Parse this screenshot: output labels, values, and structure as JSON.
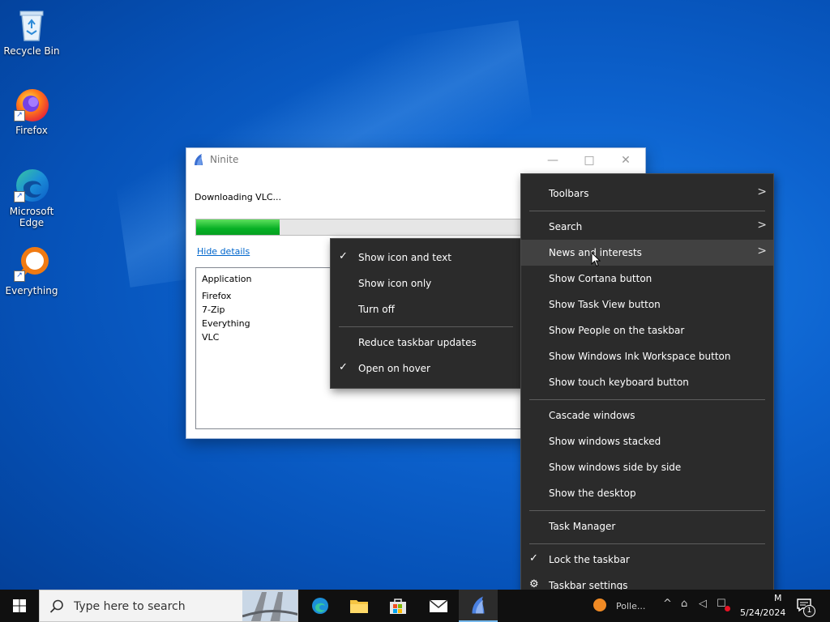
{
  "desktop": {
    "icons": [
      {
        "label": "Recycle Bin"
      },
      {
        "label": "Firefox"
      },
      {
        "label": "Microsoft Edge"
      },
      {
        "label": "Everything"
      }
    ]
  },
  "ninite": {
    "title": "Ninite",
    "status": "Downloading VLC...",
    "progress_fraction": 0.19,
    "hide_details": "Hide details",
    "list_header": "Application",
    "apps": [
      "Firefox",
      "7-Zip",
      "Everything",
      "VLC"
    ]
  },
  "submenu": {
    "items": [
      {
        "label": "Show icon and text",
        "checked": true
      },
      {
        "label": "Show icon only",
        "checked": false
      },
      {
        "label": "Turn off",
        "checked": false
      },
      {
        "label": "Reduce taskbar updates",
        "checked": false
      },
      {
        "label": "Open on hover",
        "checked": true
      }
    ]
  },
  "context_menu": {
    "items": [
      {
        "label": "Toolbars"
      },
      {
        "label": "Search"
      },
      {
        "label": "News and interests"
      },
      {
        "label": "Show Cortana button"
      },
      {
        "label": "Show Task View button"
      },
      {
        "label": "Show People on the taskbar"
      },
      {
        "label": "Show Windows Ink Workspace button"
      },
      {
        "label": "Show touch keyboard button"
      },
      {
        "label": "Cascade windows"
      },
      {
        "label": "Show windows stacked"
      },
      {
        "label": "Show windows side by side"
      },
      {
        "label": "Show the desktop"
      },
      {
        "label": "Task Manager"
      },
      {
        "label": "Lock the taskbar",
        "checked": true
      },
      {
        "label": "Taskbar settings"
      }
    ],
    "highlighted": "News and interests"
  },
  "taskbar": {
    "search_placeholder": "Type here to search",
    "weather_text": "Polle...",
    "time_fragment": "M",
    "date": "5/24/2024",
    "notification_count": "1"
  },
  "colors": {
    "menu_bg": "#2b2b2b",
    "menu_highlight": "#414141",
    "progress": "#06b025",
    "link": "#0066cc",
    "taskbar": "#101010"
  }
}
